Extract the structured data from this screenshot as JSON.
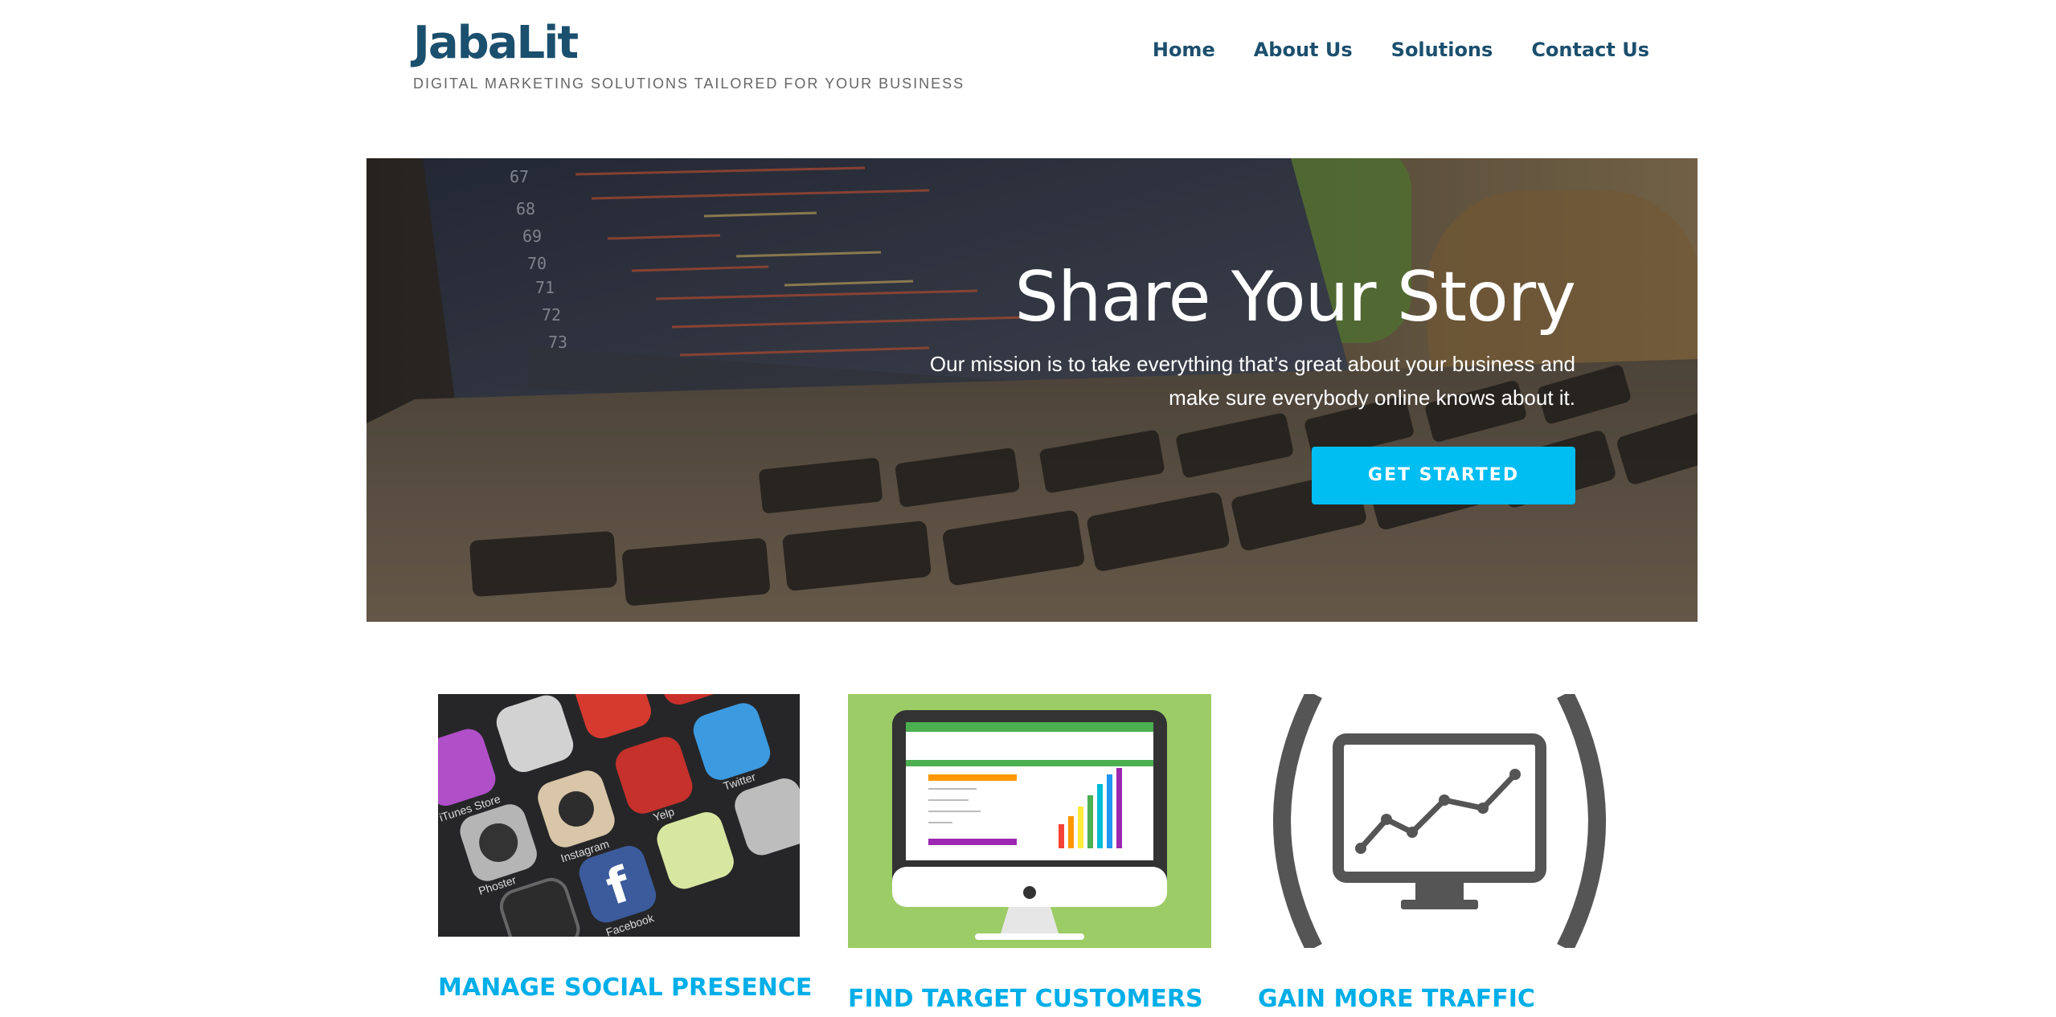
{
  "site": {
    "logo": "JabaLit",
    "tagline": "DIGITAL MARKETING SOLUTIONS TAILORED FOR YOUR BUSINESS"
  },
  "nav": {
    "items": [
      {
        "label": "Home"
      },
      {
        "label": "About Us"
      },
      {
        "label": "Solutions"
      },
      {
        "label": "Contact Us"
      }
    ]
  },
  "hero": {
    "title": "Share Your Story",
    "subtitle": "Our mission is to take everything that’s great about your business and make sure everybody online knows about it.",
    "cta_label": "GET STARTED",
    "code_lines": [
      "67",
      "68",
      "69",
      "70",
      "71",
      "72",
      "73"
    ]
  },
  "features": [
    {
      "title": "MANAGE SOCIAL PRESENCE",
      "image": "social-media-apps-icon",
      "app_labels": [
        "iTunes Store",
        "Instagram",
        "Yelp",
        "Twitter",
        "Facebook",
        "Phoster"
      ]
    },
    {
      "title": "FIND TARGET CUSTOMERS",
      "image": "monitor-spreadsheet-icon"
    },
    {
      "title": "GAIN MORE TRAFFIC",
      "image": "traffic-chart-monitor-icon"
    }
  ],
  "colors": {
    "brand": "#1b4f6e",
    "accent": "#00bdf2",
    "feature_title": "#00aee8",
    "tagline": "#666666"
  }
}
